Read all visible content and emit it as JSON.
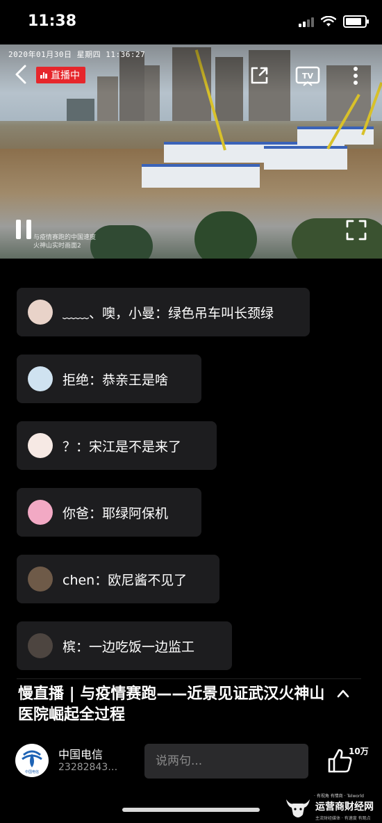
{
  "status_bar": {
    "time": "11:38"
  },
  "video": {
    "timestamp": "2020年01月30日  星期四  11:36:27",
    "live_label": "直播中",
    "watermark_line1": "与疫情赛跑的中国速度",
    "watermark_line2": "火神山实时画面2",
    "accent": "#e6262b"
  },
  "comments": [
    {
      "text": "﹏﹏、噢，小曼：绿色吊车叫长颈绿",
      "avatar_color": "#e9d3c9"
    },
    {
      "text": "拒绝：恭亲王是啥",
      "avatar_color": "#cfe2f0"
    },
    {
      "text": "？：宋江是不是来了",
      "avatar_color": "#f6e9e4"
    },
    {
      "text": "你爸：耶绿阿保机",
      "avatar_color": "#f2a9c4"
    },
    {
      "text": "chen：欧尼酱不见了",
      "avatar_color": "#6e5a48"
    },
    {
      "text": "槟：一边吃饭一边监工",
      "avatar_color": "#4d4540"
    }
  ],
  "title": "慢直播 | 与疫情赛跑——近景见证武汉火神山医院崛起全过程",
  "channel": {
    "name": "中国电信",
    "id": "23282843…",
    "logo_text": "中国电信"
  },
  "comment_input": {
    "placeholder": "说两句..."
  },
  "like": {
    "count": "10万"
  },
  "site_watermark": {
    "top": "· 有视角 有情商 · Telworld",
    "name": "运营商财经网",
    "bottom": "主流财经媒体 · 有速度 有观点"
  }
}
